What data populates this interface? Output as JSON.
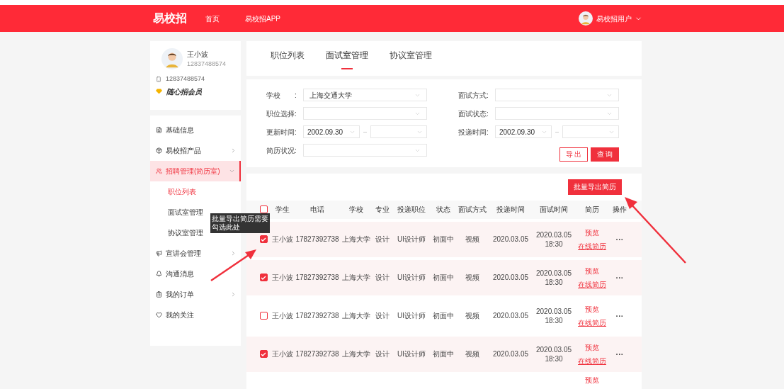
{
  "header": {
    "logo": "易校招",
    "nav": [
      {
        "label": "首页"
      },
      {
        "label": "易校招APP"
      }
    ],
    "user": "易校招用户"
  },
  "profile": {
    "name": "王小波",
    "subtitle": "12837488574",
    "phone": "12837488574",
    "membership": "随心招会员"
  },
  "menu": [
    {
      "label": "基础信息",
      "expandable": false,
      "selected": false
    },
    {
      "label": "易校招产品",
      "expandable": true,
      "expanded": false,
      "selected": false
    },
    {
      "label": "招聘管理(简历室)",
      "expandable": true,
      "expanded": true,
      "selected": true,
      "children": [
        {
          "label": "职位列表",
          "selected": true
        },
        {
          "label": "面试室管理",
          "selected": false
        },
        {
          "label": "协议室管理",
          "selected": false
        }
      ]
    },
    {
      "label": "宣讲会管理",
      "expandable": true,
      "expanded": false,
      "selected": false
    },
    {
      "label": "沟通消息",
      "expandable": false,
      "selected": false
    },
    {
      "label": "我的订单",
      "expandable": true,
      "expanded": false,
      "selected": false
    },
    {
      "label": "我的关注",
      "expandable": false,
      "selected": false
    }
  ],
  "tabs": [
    {
      "label": "职位列表",
      "selected": false
    },
    {
      "label": "面试室管理",
      "selected": true
    },
    {
      "label": "协议室管理",
      "selected": false
    }
  ],
  "filters": [
    {
      "label": "学校　　:",
      "kind": "select",
      "value": "上海交通大学"
    },
    {
      "label": "面试方式:",
      "kind": "select"
    },
    {
      "label": "职位选择:",
      "kind": "select"
    },
    {
      "label": "面试状态:",
      "kind": "select"
    },
    {
      "label": "更新时间:",
      "kind": "range",
      "value": "2002.09.30"
    },
    {
      "label": "投递时间:",
      "kind": "range",
      "value": "2002.09.30"
    },
    {
      "label": "简历状况:",
      "kind": "select"
    }
  ],
  "filter_buttons": [
    {
      "label": "导 出",
      "kind": "outline"
    },
    {
      "label": "查 询",
      "kind": "primary"
    }
  ],
  "batch_export": "批量导出简历",
  "tooltip": "批量导出简历需要勾选此处",
  "table": {
    "select_all": false,
    "columns": [
      "学生",
      "电话",
      "学校",
      "专业",
      "投递职位",
      "状态",
      "面试方式",
      "投递时间",
      "面试时间",
      "简历",
      "操作"
    ],
    "rows": [
      {
        "checked": true,
        "student": "王小波",
        "phone": "17827392738",
        "school": "上海大学",
        "major": "设计",
        "position": "UI设计师",
        "status": "初面中",
        "method": "视频",
        "applied": "2020.03.05",
        "interview": [
          "2020.03.05",
          "18:30"
        ],
        "preview": "预览",
        "online": "在线简历",
        "more": "···"
      },
      {
        "checked": true,
        "student": "王小波",
        "phone": "17827392738",
        "school": "上海大学",
        "major": "设计",
        "position": "UI设计师",
        "status": "初面中",
        "method": "视频",
        "applied": "2020.03.05",
        "interview": [
          "2020.03.05",
          "18:30"
        ],
        "preview": "预览",
        "online": "在线简历",
        "more": "···"
      },
      {
        "checked": false,
        "student": "王小波",
        "phone": "17827392738",
        "school": "上海大学",
        "major": "设计",
        "position": "UI设计师",
        "status": "初面中",
        "method": "视频",
        "applied": "2020.03.05",
        "interview": [
          "2020.03.05",
          "18:30"
        ],
        "preview": "预览",
        "online": "在线简历",
        "more": "···"
      },
      {
        "checked": true,
        "student": "王小波",
        "phone": "17827392738",
        "school": "上海大学",
        "major": "设计",
        "position": "UI设计师",
        "status": "初面中",
        "method": "视频",
        "applied": "2020.03.05",
        "interview": [
          "2020.03.05",
          "18:30"
        ],
        "preview": "预览",
        "online": "在线简历",
        "more": "···"
      }
    ],
    "partial_row": {
      "preview": "预览"
    }
  }
}
